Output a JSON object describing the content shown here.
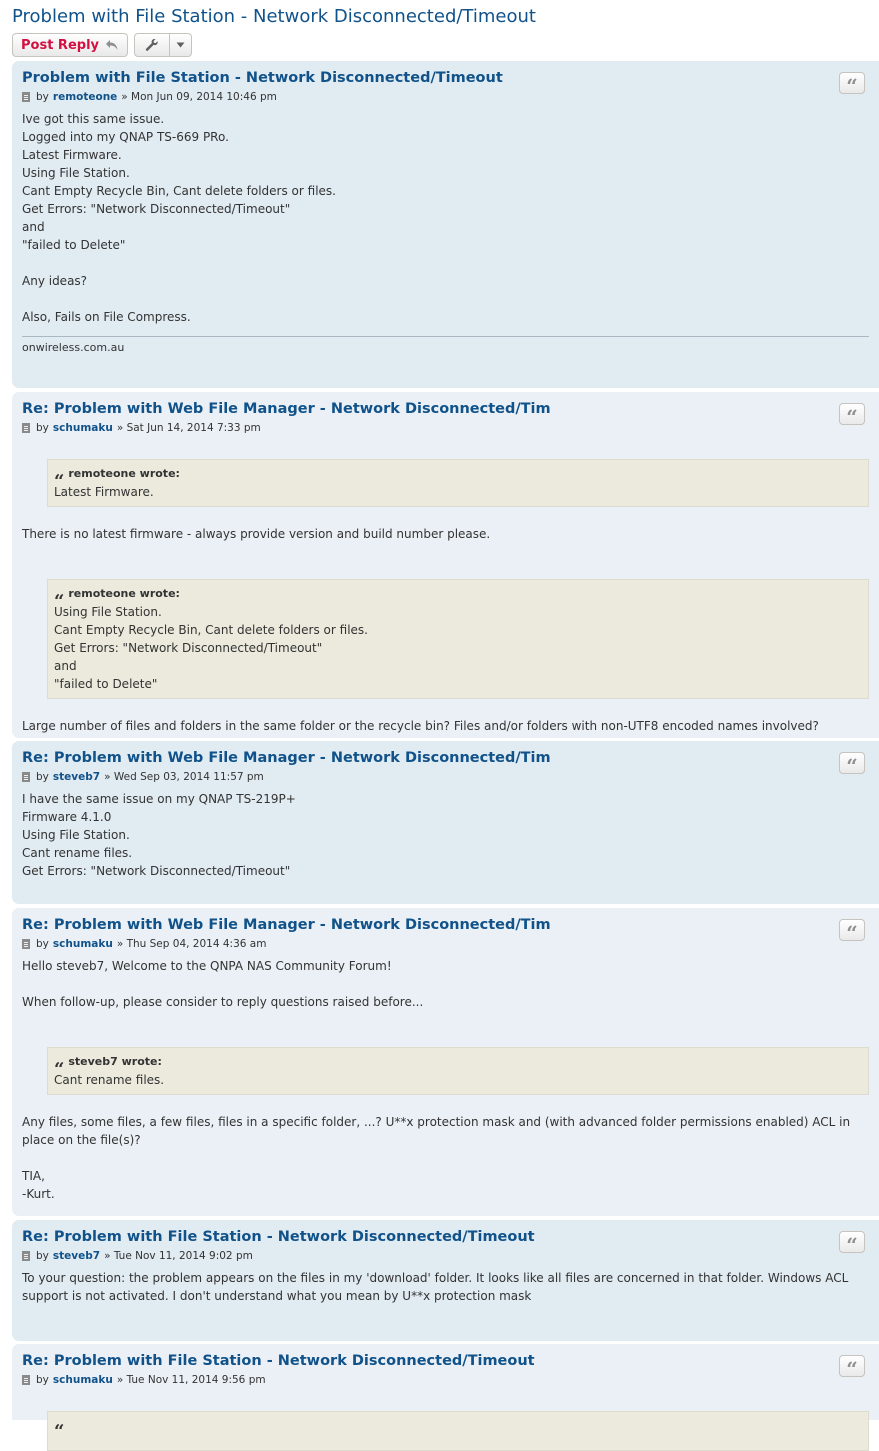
{
  "topic": {
    "title": "Problem with File Station - Network Disconnected/Timeout",
    "post_reply_label": "Post Reply"
  },
  "posts": [
    {
      "title": "Problem with File Station - Network Disconnected/Timeout",
      "by": "by",
      "author": "remoteone",
      "date": "» Mon Jun 09, 2014 10:46 pm",
      "lines": [
        "Ive got this same issue.",
        "Logged into my QNAP TS-669 PRo.",
        "Latest Firmware.",
        "Using File Station.",
        "Cant Empty Recycle Bin, Cant delete folders or files.",
        "Get Errors: \"Network Disconnected/Timeout\"",
        "and",
        "\"failed to Delete\"",
        "",
        "Any ideas?",
        "",
        "Also, Fails on File Compress."
      ],
      "signature": "onwireless.com.au"
    },
    {
      "title": "Re: Problem with Web File Manager - Network Disconnected/Tim",
      "by": "by",
      "author": "schumaku",
      "date": "» Sat Jun 14, 2014 7:33 pm",
      "quote1": {
        "cite": "remoteone wrote:",
        "lines": [
          "Latest Firmware."
        ]
      },
      "text1": "There is no latest firmware - always provide version and build number please.",
      "quote2": {
        "cite": "remoteone wrote:",
        "lines": [
          "Using File Station.",
          "Cant Empty Recycle Bin, Cant delete folders or files.",
          "Get Errors: \"Network Disconnected/Timeout\"",
          "and",
          "\"failed to Delete\""
        ]
      },
      "text2": "Large number of files and folders in the same folder or the recycle bin? Files and/or folders with non-UTF8 encoded names involved?"
    },
    {
      "title": "Re: Problem with Web File Manager - Network Disconnected/Tim",
      "by": "by",
      "author": "steveb7",
      "date": "» Wed Sep 03, 2014 11:57 pm",
      "lines": [
        "I have the same issue on my QNAP TS-219P+",
        "Firmware 4.1.0",
        "Using File Station.",
        "Cant rename files.",
        "Get Errors: \"Network Disconnected/Timeout\""
      ]
    },
    {
      "title": "Re: Problem with Web File Manager - Network Disconnected/Tim",
      "by": "by",
      "author": "schumaku",
      "date": "» Thu Sep 04, 2014 4:36 am",
      "lines_before": [
        "Hello steveb7, Welcome to the QNPA NAS Community Forum!",
        "",
        "When follow-up, please consider to reply questions raised before..."
      ],
      "quote": {
        "cite": "steveb7 wrote:",
        "lines": [
          "Cant rename files."
        ]
      },
      "text_after": "Any files, some files, a few files, files in a specific folder, ...? U**x protection mask and (with advanced folder permissions enabled) ACL in place on the file(s)?",
      "lines_after": [
        "",
        "TIA,",
        "-Kurt."
      ]
    },
    {
      "title": "Re: Problem with File Station - Network Disconnected/Timeout",
      "by": "by",
      "author": "steveb7",
      "date": "» Tue Nov 11, 2014 9:02 pm",
      "text": "To your question: the problem appears on the files in my 'download' folder. It looks like all files are concerned in that folder. Windows ACL support is not activated. I don't understand what you mean by U**x protection mask"
    },
    {
      "title": "Re: Problem with File Station - Network Disconnected/Timeout",
      "by": "by",
      "author": "schumaku",
      "date": "» Tue Nov 11, 2014 9:56 pm"
    }
  ]
}
